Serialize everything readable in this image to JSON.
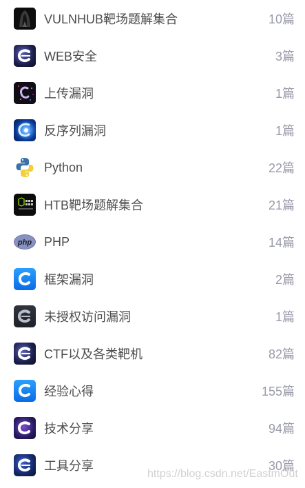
{
  "categories": [
    {
      "name": "VULNHUB靶场题解集合",
      "count": "10篇",
      "icon": "hooded-figure-icon"
    },
    {
      "name": "WEB安全",
      "count": "3篇",
      "icon": "csdn-c-logo-icon"
    },
    {
      "name": "上传漏洞",
      "count": "1篇",
      "icon": "bug-art-icon"
    },
    {
      "name": "反序列漏洞",
      "count": "1篇",
      "icon": "blue-light-c-icon"
    },
    {
      "name": "Python",
      "count": "22篇",
      "icon": "python-logo-icon"
    },
    {
      "name": "HTB靶场题解集合",
      "count": "21篇",
      "icon": "hackthebox-icon"
    },
    {
      "name": "PHP",
      "count": "14篇",
      "icon": "php-logo-icon"
    },
    {
      "name": "框架漏洞",
      "count": "2篇",
      "icon": "csdn-c-blue-icon"
    },
    {
      "name": "未授权访问漏洞",
      "count": "1篇",
      "icon": "csdn-c-grey-icon"
    },
    {
      "name": "CTF以及各类靶机",
      "count": "82篇",
      "icon": "csdn-c-logo-icon"
    },
    {
      "name": "经验心得",
      "count": "155篇",
      "icon": "csdn-c-cyan-icon"
    },
    {
      "name": "技术分享",
      "count": "94篇",
      "icon": "csdn-c-purple-icon"
    },
    {
      "name": "工具分享",
      "count": "30篇",
      "icon": "csdn-c-navy-icon"
    }
  ],
  "watermark": "https://blog.csdn.net/EastmOut"
}
